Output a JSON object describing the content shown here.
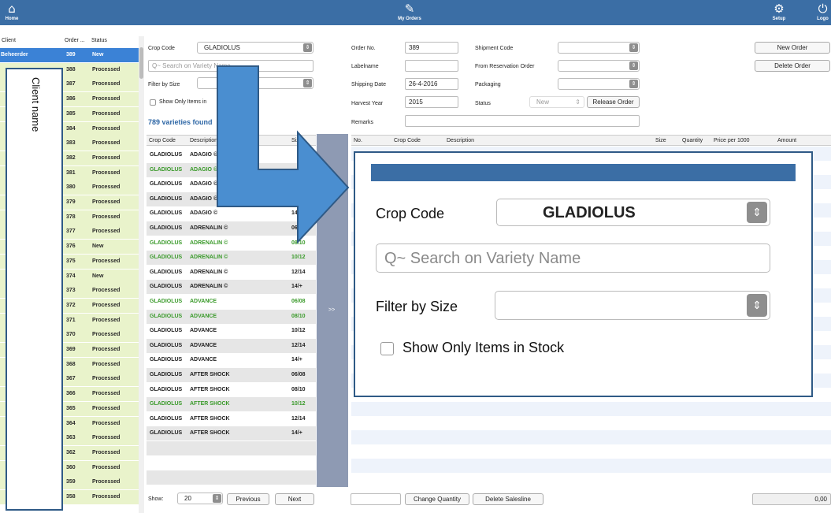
{
  "topbar": {
    "home_label": "Home",
    "orders_label": "My Orders",
    "setup_label": "Setup",
    "logout_label": "Logo"
  },
  "order_list": {
    "headers": {
      "client": "Client",
      "order": "Order ...",
      "status": "Status"
    },
    "rows": [
      {
        "client": "Beheerder",
        "order": "389",
        "status": "New"
      },
      {
        "client": "",
        "order": "388",
        "status": "Processed"
      },
      {
        "client": "",
        "order": "387",
        "status": "Processed"
      },
      {
        "client": "",
        "order": "386",
        "status": "Processed"
      },
      {
        "client": "",
        "order": "385",
        "status": "Processed"
      },
      {
        "client": "",
        "order": "384",
        "status": "Processed"
      },
      {
        "client": "",
        "order": "383",
        "status": "Processed"
      },
      {
        "client": "",
        "order": "382",
        "status": "Processed"
      },
      {
        "client": "",
        "order": "381",
        "status": "Processed"
      },
      {
        "client": "",
        "order": "380",
        "status": "Processed"
      },
      {
        "client": "",
        "order": "379",
        "status": "Processed"
      },
      {
        "client": "",
        "order": "378",
        "status": "Processed"
      },
      {
        "client": "",
        "order": "377",
        "status": "Processed"
      },
      {
        "client": "",
        "order": "376",
        "status": "New"
      },
      {
        "client": "",
        "order": "375",
        "status": "Processed"
      },
      {
        "client": "",
        "order": "374",
        "status": "New"
      },
      {
        "client": "",
        "order": "373",
        "status": "Processed"
      },
      {
        "client": "",
        "order": "372",
        "status": "Processed"
      },
      {
        "client": "",
        "order": "371",
        "status": "Processed"
      },
      {
        "client": "",
        "order": "370",
        "status": "Processed"
      },
      {
        "client": "",
        "order": "369",
        "status": "Processed"
      },
      {
        "client": "",
        "order": "368",
        "status": "Processed"
      },
      {
        "client": "",
        "order": "367",
        "status": "Processed"
      },
      {
        "client": "",
        "order": "366",
        "status": "Processed"
      },
      {
        "client": "",
        "order": "365",
        "status": "Processed"
      },
      {
        "client": "",
        "order": "364",
        "status": "Processed"
      },
      {
        "client": "",
        "order": "363",
        "status": "Processed"
      },
      {
        "client": "",
        "order": "362",
        "status": "Processed"
      },
      {
        "client": "",
        "order": "360",
        "status": "Processed"
      },
      {
        "client": "",
        "order": "359",
        "status": "Processed"
      },
      {
        "client": "",
        "order": "358",
        "status": "Processed"
      }
    ],
    "client_callout": "Client name"
  },
  "filters": {
    "crop_code_label": "Crop Code",
    "crop_code_value": "GLADIOLUS",
    "search_placeholder": "Q~ Search on Variety Name",
    "filter_size_label": "Filter by Size",
    "stock_label": "Show Only Items in Stock",
    "stock_label_short": "Show Only Items in",
    "found_text": "789 varieties found"
  },
  "varieties": {
    "headers": {
      "crop": "Crop Code",
      "desc": "Description",
      "size": "Size"
    },
    "rows": [
      {
        "crop": "GLADIOLUS",
        "desc": "ADAGIO ©",
        "size": "",
        "green": false
      },
      {
        "crop": "GLADIOLUS",
        "desc": "ADAGIO ©",
        "size": "",
        "green": true
      },
      {
        "crop": "GLADIOLUS",
        "desc": "ADAGIO ©",
        "size": "",
        "green": false
      },
      {
        "crop": "GLADIOLUS",
        "desc": "ADAGIO ©",
        "size": "12/14",
        "green": false
      },
      {
        "crop": "GLADIOLUS",
        "desc": "ADAGIO ©",
        "size": "14/+",
        "green": false
      },
      {
        "crop": "GLADIOLUS",
        "desc": "ADRENALIN ©",
        "size": "06/08",
        "green": false
      },
      {
        "crop": "GLADIOLUS",
        "desc": "ADRENALIN ©",
        "size": "08/10",
        "green": true
      },
      {
        "crop": "GLADIOLUS",
        "desc": "ADRENALIN ©",
        "size": "10/12",
        "green": true
      },
      {
        "crop": "GLADIOLUS",
        "desc": "ADRENALIN ©",
        "size": "12/14",
        "green": false
      },
      {
        "crop": "GLADIOLUS",
        "desc": "ADRENALIN ©",
        "size": "14/+",
        "green": false
      },
      {
        "crop": "GLADIOLUS",
        "desc": "ADVANCE",
        "size": "06/08",
        "green": true
      },
      {
        "crop": "GLADIOLUS",
        "desc": "ADVANCE",
        "size": "08/10",
        "green": true
      },
      {
        "crop": "GLADIOLUS",
        "desc": "ADVANCE",
        "size": "10/12",
        "green": false
      },
      {
        "crop": "GLADIOLUS",
        "desc": "ADVANCE",
        "size": "12/14",
        "green": false
      },
      {
        "crop": "GLADIOLUS",
        "desc": "ADVANCE",
        "size": "14/+",
        "green": false
      },
      {
        "crop": "GLADIOLUS",
        "desc": "AFTER SHOCK",
        "size": "06/08",
        "green": false
      },
      {
        "crop": "GLADIOLUS",
        "desc": "AFTER SHOCK",
        "size": "08/10",
        "green": false
      },
      {
        "crop": "GLADIOLUS",
        "desc": "AFTER SHOCK",
        "size": "10/12",
        "green": true
      },
      {
        "crop": "GLADIOLUS",
        "desc": "AFTER SHOCK",
        "size": "12/14",
        "green": false
      },
      {
        "crop": "GLADIOLUS",
        "desc": "AFTER SHOCK",
        "size": "14/+",
        "green": false
      }
    ],
    "show_label": "Show:",
    "page_size": "20",
    "previous_label": "Previous",
    "next_label": "Next",
    "move_label": ">>"
  },
  "order_form": {
    "order_no_label": "Order No.",
    "order_no_value": "389",
    "labelname_label": "Labelname",
    "shipping_date_label": "Shipping Date",
    "shipping_date_value": "26-4-2016",
    "harvest_year_label": "Harvest Year",
    "harvest_year_value": "2015",
    "remarks_label": "Remarks",
    "shipment_code_label": "Shipment Code",
    "from_reservation_label": "From Reservation Order",
    "packaging_label": "Packaging",
    "status_label": "Status",
    "status_value": "New",
    "release_order_label": "Release Order",
    "new_order_label": "New Order",
    "delete_order_label": "Delete Order"
  },
  "order_lines": {
    "headers": {
      "no": "No.",
      "crop": "Crop Code",
      "desc": "Description",
      "size": "Size",
      "qty": "Quantity",
      "price": "Price per 1000",
      "amount": "Amount"
    },
    "change_qty_label": "Change Quantity",
    "delete_line_label": "Delete Salesline",
    "total_value": "0,00"
  },
  "colors": {
    "topbar": "#3b6ea5",
    "list_bg": "#e9f3cb",
    "selected_row": "#3b82d6",
    "green_text": "#3a9a2a",
    "arrow_fill": "#4a8ed0"
  }
}
